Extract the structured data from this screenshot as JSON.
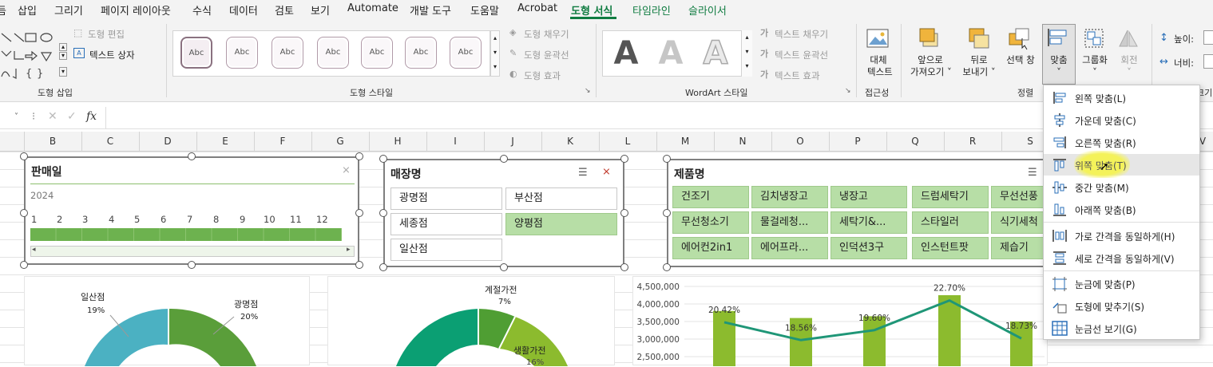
{
  "menu": {
    "tabs": [
      "듬",
      "삽입",
      "그리기",
      "페이지 레이아웃",
      "수식",
      "데이터",
      "검토",
      "보기",
      "Automate",
      "개발 도구",
      "도움말",
      "Acrobat",
      "도형 서식",
      "타임라인",
      "슬라이서"
    ]
  },
  "ribbon": {
    "insert_shapes": {
      "edit_shape": "도형 편집",
      "text_box": "텍스트 상자",
      "group_label": "도형 삽입"
    },
    "shape_styles": {
      "sample": "Abc",
      "fill": "도형 채우기",
      "outline": "도형 윤곽선",
      "effects": "도형 효과",
      "group_label": "도형 스타일"
    },
    "wordart": {
      "letter": "A",
      "text_fill": "텍스트 채우기",
      "text_outline": "텍스트 윤곽선",
      "text_effects": "텍스트 효과",
      "group_label": "WordArt 스타일"
    },
    "accessibility": {
      "alt_text_1": "대체",
      "alt_text_2": "텍스트",
      "group_label": "접근성"
    },
    "arrange": {
      "bring_forward_1": "앞으로",
      "bring_forward_2": "가져오기",
      "send_backward_1": "뒤로",
      "send_backward_2": "보내기",
      "selection_pane": "선택 창",
      "align": "맞춤",
      "group": "그룹화",
      "rotate": "회전",
      "group_label": "정렬"
    },
    "size": {
      "height": "높이:",
      "width": "너비:",
      "label_partial": "크기"
    }
  },
  "formula_bar": {
    "fx": "fx",
    "value": ""
  },
  "columns": [
    "B",
    "C",
    "D",
    "E",
    "F",
    "G",
    "H",
    "I",
    "J",
    "K",
    "L",
    "M",
    "N",
    "O",
    "P",
    "Q",
    "R",
    "S",
    "V"
  ],
  "slicers": {
    "date": {
      "title": "판매일",
      "year": "2024",
      "months": [
        "1",
        "2",
        "3",
        "4",
        "5",
        "6",
        "7",
        "8",
        "9",
        "10",
        "11",
        "12"
      ]
    },
    "store": {
      "title": "매장명",
      "items": [
        "광명점",
        "부산점",
        "세종점",
        "양평점",
        "일산점"
      ],
      "selected": [
        "양평점"
      ]
    },
    "product": {
      "title": "제품명",
      "items": [
        "건조기",
        "김치냉장고",
        "냉장고",
        "드럼세탁기",
        "무선선풍",
        "무선청소기",
        "물걸레청...",
        "세탁기&...",
        "스타일러",
        "식기세척",
        "에어컨2in1",
        "에어프라...",
        "인덕션3구",
        "인스턴트팟",
        "제습기"
      ]
    }
  },
  "chart1": {
    "labels": [
      {
        "name": "일산점",
        "pct": "19%"
      },
      {
        "name": "광명점",
        "pct": "20%"
      }
    ]
  },
  "chart2": {
    "labels": [
      {
        "name": "계절가전",
        "pct": "7%"
      },
      {
        "name": "생활가전",
        "pct": "16%"
      }
    ]
  },
  "chart_data": {
    "type": "bar",
    "y_ticks": [
      "4,500,000",
      "4,000,000",
      "3,500,000",
      "3,000,000",
      "2,500,000"
    ],
    "ylim": [
      2500000,
      4500000
    ],
    "values": [
      3800000,
      3600000,
      3650000,
      4250000,
      3500000
    ],
    "line_pcts": [
      "20.42%",
      "18.56%",
      "19.60%",
      "22.70%",
      "18.73%"
    ],
    "line_values": [
      20.42,
      18.56,
      19.6,
      22.7,
      18.73
    ],
    "colors": {
      "bar": "#8cbb2e",
      "line": "#1f9677"
    }
  },
  "align_menu": {
    "items": [
      "왼쪽 맞춤(L)",
      "가운데 맞춤(C)",
      "오른쪽 맞춤(R)",
      "위쪽 맞춤(T)",
      "중간 맞춤(M)",
      "아래쪽 맞춤(B)",
      "가로 간격을 동일하게(H)",
      "세로 간격을 동일하게(V)",
      "눈금에 맞춤(P)",
      "도형에 맞추기(S)",
      "눈금선 보기(G)"
    ],
    "hovered": "위쪽 맞춤(T)"
  },
  "colors": {
    "accent": "#107c41",
    "slicer_selected": "#b7dea6",
    "donut_green": "#5a9e3a",
    "donut_teal": "#4bb1c2"
  }
}
